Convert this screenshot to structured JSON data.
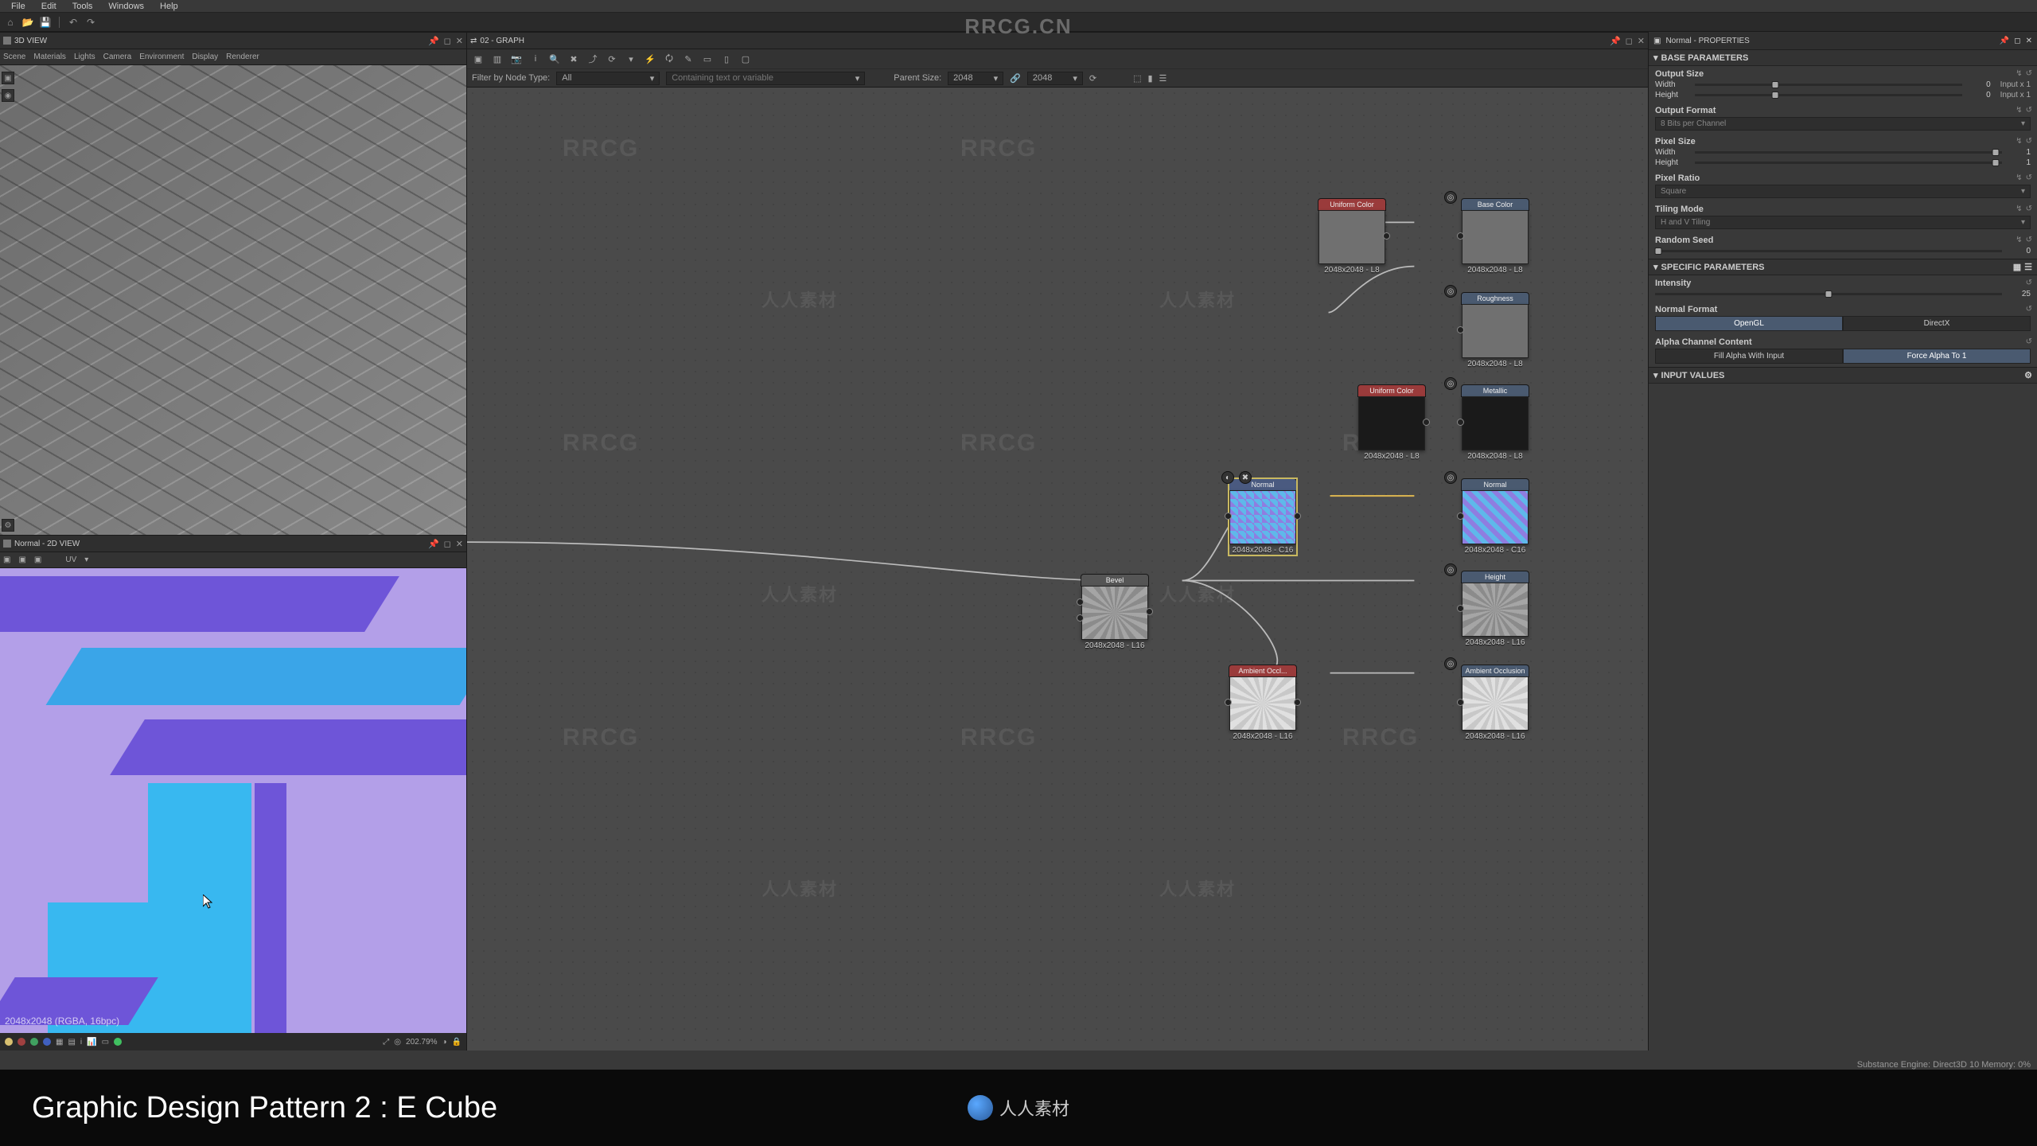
{
  "brand": "RRCG.CN",
  "menu": {
    "file": "File",
    "edit": "Edit",
    "tools": "Tools",
    "windows": "Windows",
    "help": "Help"
  },
  "view3d": {
    "title": "3D VIEW",
    "tabs": {
      "scene": "Scene",
      "materials": "Materials",
      "lights": "Lights",
      "camera": "Camera",
      "environment": "Environment",
      "display": "Display",
      "renderer": "Renderer"
    }
  },
  "view2d": {
    "title": "Normal - 2D VIEW",
    "uv": "UV",
    "info": "2048x2048 (RGBA, 16bpc)",
    "zoom": "202.79%"
  },
  "graph": {
    "tab": "02 - GRAPH",
    "filter_label": "Filter by Node Type:",
    "filter_value": "All",
    "search_placeholder": "Containing text or variable",
    "parent_label": "Parent Size:",
    "parent_value": "2048",
    "size_value": "2048",
    "nodes": {
      "uniform1": {
        "title": "Uniform Color",
        "res": "2048x2048 - L8"
      },
      "uniform2": {
        "title": "Uniform Color",
        "res": "2048x2048 - L8"
      },
      "ao": {
        "title": "Ambient Occl...",
        "res": "2048x2048 - L16"
      },
      "normal_src": {
        "title": "Normal",
        "res": "2048x2048 - C16"
      },
      "bevel": {
        "title": "Bevel",
        "res": "2048x2048 - L16"
      },
      "out_basecolor": {
        "title": "Base Color",
        "res": "2048x2048 - L8"
      },
      "out_roughness": {
        "title": "Roughness",
        "res": "2048x2048 - L8"
      },
      "out_metallic": {
        "title": "Metallic",
        "res": "2048x2048 - L8"
      },
      "out_normal": {
        "title": "Normal",
        "res": "2048x2048 - C16"
      },
      "out_height": {
        "title": "Height",
        "res": "2048x2048 - L16"
      },
      "out_ao": {
        "title": "Ambient Occlusion",
        "res": "2048x2048 - L16"
      }
    }
  },
  "props": {
    "title": "Normal - PROPERTIES",
    "base_params": "BASE PARAMETERS",
    "output_size": "Output Size",
    "width_label": "Width",
    "width_val": "0",
    "width_extra": "Input x 1",
    "height_label": "Height",
    "height_val": "0",
    "height_extra": "Input x 1",
    "output_format": "Output Format",
    "output_format_val": "8 Bits per Channel",
    "pixel_size": "Pixel Size",
    "ps_width_val": "1",
    "ps_height_val": "1",
    "pixel_ratio": "Pixel Ratio",
    "pixel_ratio_val": "Square",
    "tiling": "Tiling Mode",
    "tiling_val": "H and V Tiling",
    "random_seed": "Random Seed",
    "random_seed_val": "0",
    "specific": "SPECIFIC PARAMETERS",
    "intensity": "Intensity",
    "intensity_val": "25",
    "normal_format": "Normal Format",
    "opengl": "OpenGL",
    "directx": "DirectX",
    "alpha": "Alpha Channel Content",
    "alpha_fill": "Fill Alpha With Input",
    "alpha_force": "Force Alpha To 1",
    "input_values": "INPUT VALUES"
  },
  "status_bar": "Substance Engine: Direct3D 10   Memory: 0%",
  "caption": "Graphic Design Pattern 2 : E Cube",
  "logo_text": "人人素材"
}
